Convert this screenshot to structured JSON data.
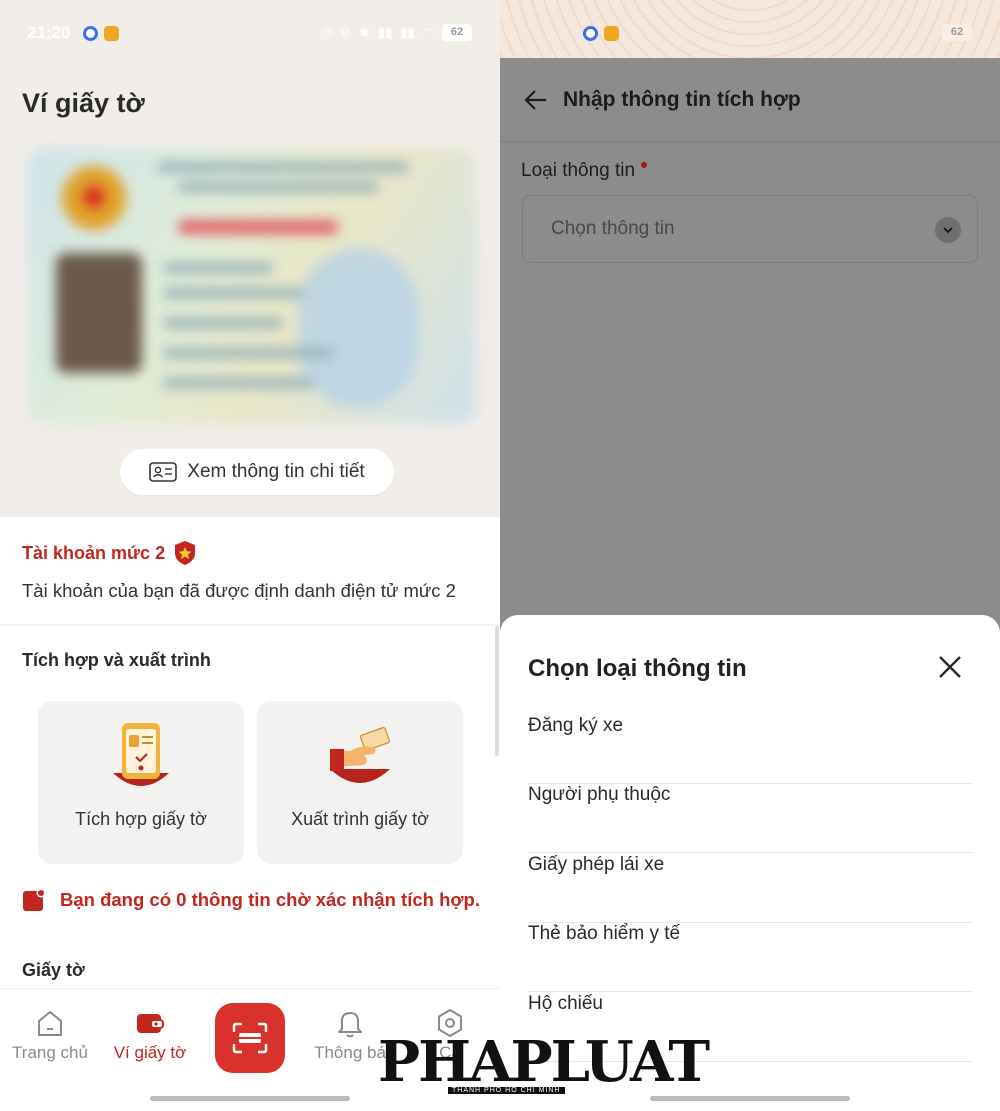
{
  "left": {
    "status": {
      "time": "21:20",
      "battery": "62"
    },
    "title": "Ví giấy tờ",
    "detail_button": "Xem thông tin chi tiết",
    "account": {
      "level": "Tài khoản mức 2",
      "description": "Tài khoản của bạn đã được định danh điện tử mức 2"
    },
    "integration": {
      "heading": "Tích hợp và xuất trình",
      "tiles": [
        {
          "label": "Tích hợp giấy tờ",
          "icon": "phone-id-card-icon"
        },
        {
          "label": "Xuất trình giấy tờ",
          "icon": "hand-card-icon"
        }
      ],
      "pending": "Bạn đang có 0 thông tin chờ xác nhận tích hợp."
    },
    "documents_heading": "Giấy tờ",
    "nav": {
      "items": [
        {
          "label": "Trang chủ",
          "icon": "home-icon"
        },
        {
          "label": "Ví giấy tờ",
          "icon": "wallet-icon",
          "active": true
        },
        {
          "label": "",
          "icon": "scan-icon"
        },
        {
          "label": "Thông bá",
          "icon": "bell-icon"
        },
        {
          "label": "Cà",
          "icon": "settings-icon"
        }
      ]
    }
  },
  "right": {
    "status": {
      "battery": "62"
    },
    "appbar_title": "Nhập thông tin tích hợp",
    "field": {
      "label": "Loại thông tin",
      "placeholder": "Chọn thông tin"
    },
    "sheet": {
      "title": "Chọn loại thông tin",
      "options": [
        "Đăng ký xe",
        "Người phụ thuộc",
        "Giấy phép lái xe",
        "Thẻ bảo hiểm y tế",
        "Hộ chiếu"
      ]
    }
  },
  "watermark": {
    "text": "PHAPLUAT",
    "subtitle": "THÀNH PHỐ HỒ CHÍ MINH"
  },
  "colors": {
    "brand_red": "#c2261e",
    "scan_red": "#d8322a",
    "overlay_gray": "#8c8c8c"
  }
}
